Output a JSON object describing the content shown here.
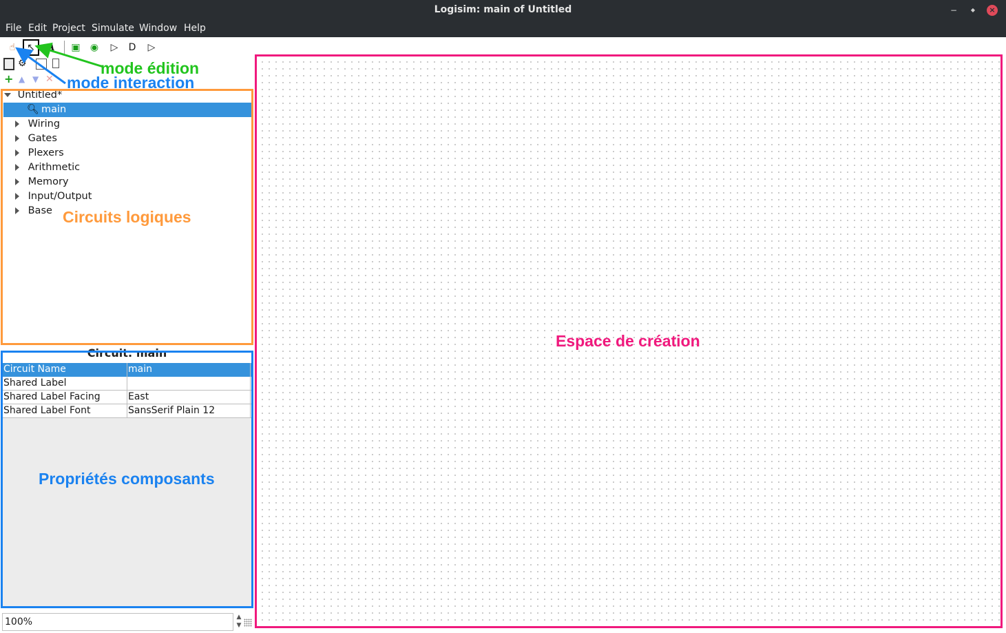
{
  "window": {
    "title": "Logisim: main of Untitled",
    "minimize_glyph": "−",
    "restore_glyph": "◆",
    "close_glyph": "×"
  },
  "menu": [
    "File",
    "Edit",
    "Project",
    "Simulate",
    "Window",
    "Help"
  ],
  "toolbar": {
    "tools": [
      {
        "icon": "hand-poke-icon",
        "glyph": "☝",
        "selected": false
      },
      {
        "icon": "arrow-select-icon",
        "glyph": "↖",
        "selected": true
      },
      {
        "icon": "text-tool-icon",
        "glyph": "A",
        "selected": false
      },
      {
        "icon": "input-pin-icon",
        "glyph": "▣",
        "selected": false
      },
      {
        "icon": "output-pin-icon",
        "glyph": "◉",
        "selected": false
      },
      {
        "icon": "not-gate-icon",
        "glyph": "▷",
        "selected": false
      },
      {
        "icon": "and-gate-icon",
        "glyph": "D",
        "selected": false
      },
      {
        "icon": "or-gate-icon",
        "glyph": "▷",
        "selected": false
      }
    ]
  },
  "explorer": {
    "root": "Untitled*",
    "selected_circuit": "main",
    "libraries": [
      "Wiring",
      "Gates",
      "Plexers",
      "Arithmetic",
      "Memory",
      "Input/Output",
      "Base"
    ]
  },
  "properties": {
    "title": "Circuit: main",
    "rows": [
      {
        "key": "Circuit Name",
        "value": "main"
      },
      {
        "key": "Shared Label",
        "value": ""
      },
      {
        "key": "Shared Label Facing",
        "value": "East"
      },
      {
        "key": "Shared Label Font",
        "value": "SansSerif Plain 12"
      }
    ]
  },
  "zoom": {
    "value": "100%"
  },
  "annotations": {
    "mode_edition": "mode édition",
    "mode_interaction": "mode interaction",
    "circuits_logiques": "Circuits logiques",
    "proprietes": "Propriétés composants",
    "espace": "Espace de création"
  },
  "colors": {
    "edition": "#22c41e",
    "interaction": "#1a82f0",
    "circuits": "#ff9a3c",
    "proprietes": "#1a82f0",
    "espace": "#f0197d",
    "selection": "#3592dc"
  }
}
